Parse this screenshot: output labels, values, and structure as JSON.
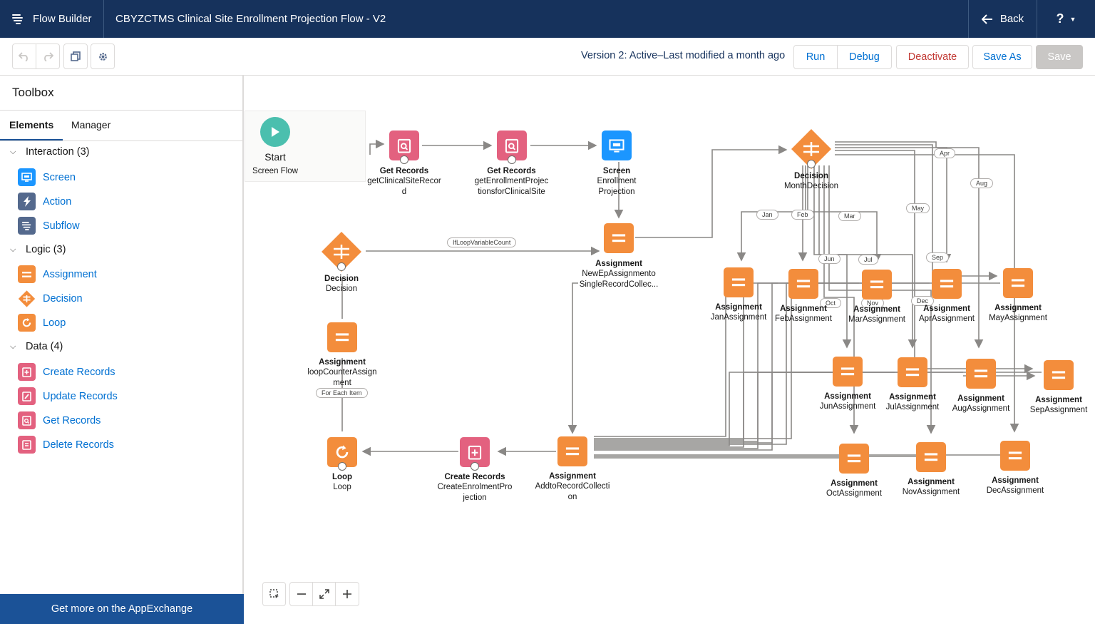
{
  "header": {
    "app_name": "Flow Builder",
    "flow_title": "CBYZCTMS Clinical Site Enrollment Projection Flow - V2",
    "back_label": "Back",
    "help_label": "?"
  },
  "toolbar": {
    "version_status": "Version 2: Active–Last modified a month ago",
    "run_label": "Run",
    "debug_label": "Debug",
    "deactivate_label": "Deactivate",
    "save_as_label": "Save As",
    "save_label": "Save"
  },
  "sidebar": {
    "title": "Toolbox",
    "tabs": [
      "Elements",
      "Manager"
    ],
    "sections": [
      {
        "label": "Interaction (3)",
        "items": [
          "Screen",
          "Action",
          "Subflow"
        ]
      },
      {
        "label": "Logic (3)",
        "items": [
          "Assignment",
          "Decision",
          "Loop"
        ]
      },
      {
        "label": "Data (4)",
        "items": [
          "Create Records",
          "Update Records",
          "Get Records",
          "Delete Records"
        ]
      }
    ],
    "appexchange_label": "Get more on the AppExchange"
  },
  "canvas": {
    "nodes": [
      {
        "id": "start",
        "kind": "Start",
        "name": "Screen Flow"
      },
      {
        "id": "get1",
        "kind": "Get Records",
        "name": "getClinicalSiteRecor\nd"
      },
      {
        "id": "get2",
        "kind": "Get Records",
        "name": "getEnrollmentProjec\ntionsforClinicalSite"
      },
      {
        "id": "screen",
        "kind": "Screen",
        "name": "Enrollment\nProjection"
      },
      {
        "id": "decision1",
        "kind": "Decision",
        "name": "Decision"
      },
      {
        "id": "assignNew",
        "kind": "Assignment",
        "name": "NewEpAssignmento\nSingleRecordCollec..."
      },
      {
        "id": "monthDecision",
        "kind": "Decision",
        "name": "MonthDecision"
      },
      {
        "id": "loopCounter",
        "kind": "Assignment",
        "name": "loopCounterAssign\nment"
      },
      {
        "id": "loop",
        "kind": "Loop",
        "name": "Loop"
      },
      {
        "id": "create",
        "kind": "Create Records",
        "name": "CreateEnrolmentPro\njection"
      },
      {
        "id": "addTo",
        "kind": "Assignment",
        "name": "AddtoRecordCollecti\non"
      },
      {
        "id": "jan",
        "kind": "Assignment",
        "name": "JanAssignment"
      },
      {
        "id": "feb",
        "kind": "Assignment",
        "name": "FebAssignment"
      },
      {
        "id": "mar",
        "kind": "Assignment",
        "name": "MarAssignment"
      },
      {
        "id": "apr",
        "kind": "Assignment",
        "name": "AprAssignment"
      },
      {
        "id": "may",
        "kind": "Assignment",
        "name": "MayAssignment"
      },
      {
        "id": "jun",
        "kind": "Assignment",
        "name": "JunAssignment"
      },
      {
        "id": "jul",
        "kind": "Assignment",
        "name": "JulAssignment"
      },
      {
        "id": "aug",
        "kind": "Assignment",
        "name": "AugAssignment"
      },
      {
        "id": "sep",
        "kind": "Assignment",
        "name": "SepAssignment"
      },
      {
        "id": "oct",
        "kind": "Assignment",
        "name": "OctAssignment"
      },
      {
        "id": "nov",
        "kind": "Assignment",
        "name": "NovAssignment"
      },
      {
        "id": "dec",
        "kind": "Assignment",
        "name": "DecAssignment"
      }
    ],
    "edge_labels": [
      "IfLoopVariableCount",
      "For Each Item",
      "Jan",
      "Feb",
      "Mar",
      "Apr",
      "May",
      "Jun",
      "Jul",
      "Aug",
      "Sep",
      "Oct",
      "Nov",
      "Dec"
    ]
  },
  "colors": {
    "header_bg": "#16325c",
    "assignment": "#f38d3c",
    "decision": "#f38d3c",
    "loop": "#f38d3c",
    "records": "#e3617f",
    "screen": "#1b96ff",
    "start": "#4bbfae",
    "link": "#0070d2",
    "deactivate": "#c23934"
  }
}
